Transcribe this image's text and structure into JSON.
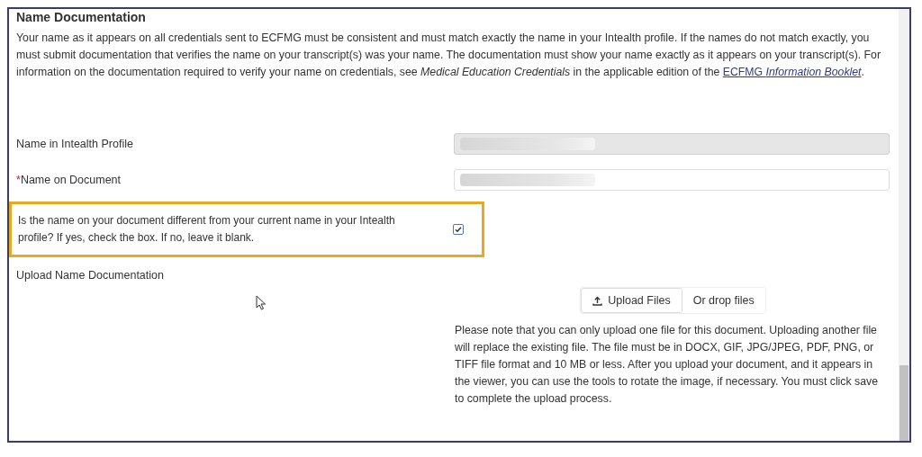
{
  "section": {
    "title": "Name Documentation",
    "intro": "Your name as it appears on all credentials sent to ECFMG must be consistent and must match exactly the name in your Intealth profile. If the names do not match exactly, you must submit documentation that verifies the name on your transcript(s) was your name. The documentation must show your name exactly as it appears on your transcript(s). For information on the documentation required to verify your name on credentials, see *Medical Education Credentials* in the applicable edition of the",
    "link": "ECFMG *Information Booklet*",
    "after": "."
  },
  "fields": [
    {
      "kind": "text",
      "label": "Name in Intealth Profile",
      "disabled": true
    },
    {
      "kind": "text",
      "marker": "*",
      "label": "Name on Document",
      "disabled": false
    },
    {
      "kind": "checkbox",
      "label": "Is the name on your document different from your current name in your Intealth profile? If yes, check the box. If no, leave it blank.",
      "checked": true,
      "highlighted": true
    }
  ],
  "upload": {
    "label": "Upload Name Documentation",
    "button": "Upload Files",
    "drop": "Or drop files",
    "note": "Please note that you can only upload one file for this document. Uploading another file will replace the existing file. The file must be in DOCX, GIF, JPG/JPEG, PDF, PNG, or TIFF file format and 10 MB or less. After you upload your document, and it appears in the viewer, you can use the tools to rotate the image, if necessary. You must click save to complete the upload process."
  }
}
